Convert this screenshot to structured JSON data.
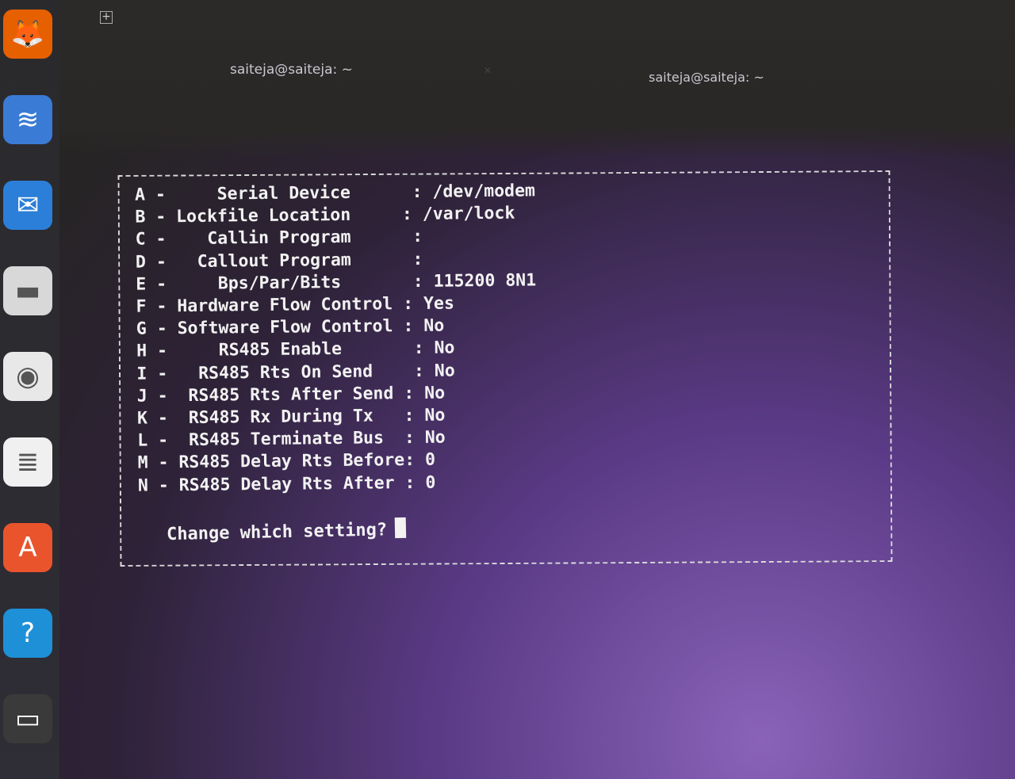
{
  "window": {
    "new_tab_icon": "new-tab-icon",
    "tabs": [
      {
        "label": "saiteja@saiteja: ~"
      },
      {
        "label": "saiteja@saiteja: ~"
      }
    ]
  },
  "dock": [
    {
      "name": "firefox",
      "icon": "firefox-icon",
      "color": "#e66000"
    },
    {
      "name": "layers",
      "icon": "layers-icon",
      "color": "#3a7bd5"
    },
    {
      "name": "thunderbird",
      "icon": "thunderbird-icon",
      "color": "#2b7fd9"
    },
    {
      "name": "files",
      "icon": "folder-icon",
      "color": "#d8d8d8"
    },
    {
      "name": "rhythmbox",
      "icon": "speaker-icon",
      "color": "#e8e8e8"
    },
    {
      "name": "writer",
      "icon": "document-icon",
      "color": "#f0f0f0"
    },
    {
      "name": "software",
      "icon": "app-store-icon",
      "color": "#e9542d"
    },
    {
      "name": "help",
      "icon": "help-icon",
      "color": "#1e90d8"
    },
    {
      "name": "terminal",
      "icon": "terminal-icon",
      "color": "#3a3a3a"
    }
  ],
  "settings": [
    {
      "key": "A",
      "label": "    Serial Device      ",
      "value": "/dev/modem"
    },
    {
      "key": "B",
      "label": "Lockfile Location     ",
      "value": "/var/lock"
    },
    {
      "key": "C",
      "label": "   Callin Program      ",
      "value": ""
    },
    {
      "key": "D",
      "label": "  Callout Program      ",
      "value": ""
    },
    {
      "key": "E",
      "label": "    Bps/Par/Bits       ",
      "value": "115200 8N1"
    },
    {
      "key": "F",
      "label": "Hardware Flow Control ",
      "value": "Yes"
    },
    {
      "key": "G",
      "label": "Software Flow Control ",
      "value": "No"
    },
    {
      "key": "H",
      "label": "    RS485 Enable       ",
      "value": "No"
    },
    {
      "key": "I",
      "label": "  RS485 Rts On Send    ",
      "value": "No"
    },
    {
      "key": "J",
      "label": " RS485 Rts After Send ",
      "value": "No"
    },
    {
      "key": "K",
      "label": " RS485 Rx During Tx   ",
      "value": "No"
    },
    {
      "key": "L",
      "label": " RS485 Terminate Bus  ",
      "value": "No"
    },
    {
      "key": "M",
      "label": "RS485 Delay Rts Before",
      "value": "0"
    },
    {
      "key": "N",
      "label": "RS485 Delay Rts After ",
      "value": "0"
    }
  ],
  "prompt": "Change which setting?"
}
